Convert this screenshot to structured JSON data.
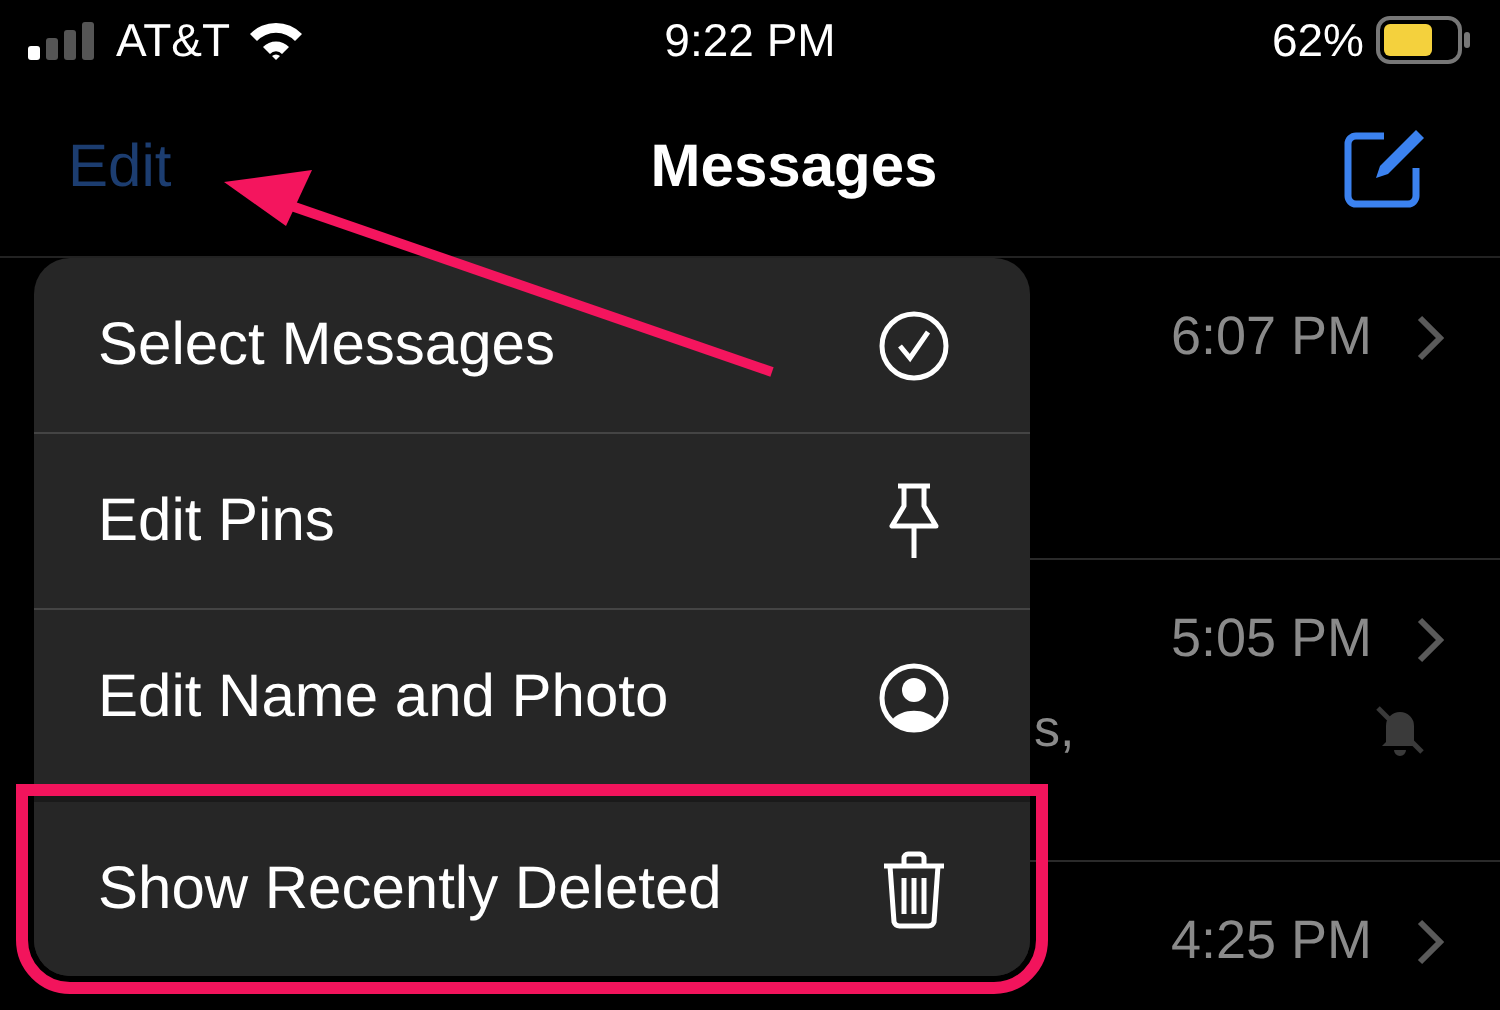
{
  "status_bar": {
    "carrier": "AT&T",
    "time": "9:22 PM",
    "battery": "62%"
  },
  "nav_bar": {
    "edit": "Edit",
    "title": "Messages"
  },
  "conversations": [
    {
      "time": "6:07 PM",
      "muted": false
    },
    {
      "time": "5:05 PM",
      "preview": "s,",
      "muted": true
    },
    {
      "time": "4:25 PM",
      "muted": false
    }
  ],
  "menu": [
    {
      "label": "Select Messages",
      "kind": "check",
      "highlighted": false
    },
    {
      "label": "Edit Pins",
      "kind": "pin",
      "highlighted": false
    },
    {
      "label": "Edit Name and Photo",
      "kind": "person",
      "highlighted": false
    },
    {
      "label": "Show Recently Deleted",
      "kind": "trash",
      "highlighted": true
    }
  ]
}
